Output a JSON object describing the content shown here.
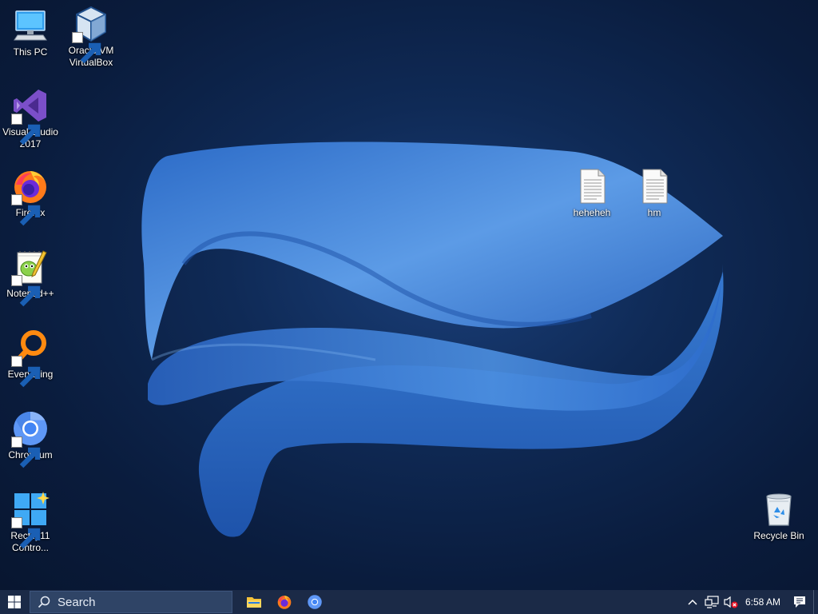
{
  "desktop": {
    "icons": {
      "this_pc": "This PC",
      "virtualbox": "Oracle VM VirtualBox",
      "visual_studio": "Visual Studio 2017",
      "firefox": "Firefox",
      "notepadpp": "Notepad++",
      "everything": "Everything",
      "chromium": "Chromium",
      "rectify": "Rectify11 Contro...",
      "heheheh": "heheheh",
      "hm": "hm",
      "recycle_bin": "Recycle Bin"
    }
  },
  "taskbar": {
    "search_placeholder": "Search",
    "pinned": [
      "file-explorer-icon",
      "firefox-icon",
      "chromium-icon"
    ],
    "clock": "6:58 AM",
    "tray_icons": [
      "chevron-up-icon",
      "network-icon",
      "volume-muted-icon",
      "notifications-icon"
    ]
  },
  "colors": {
    "taskbar_bg": "#1b2a47",
    "search_bg": "#2f4466",
    "wallpaper_bg": "#0f2a56",
    "wallpaper_accent": "#3f82d4"
  }
}
